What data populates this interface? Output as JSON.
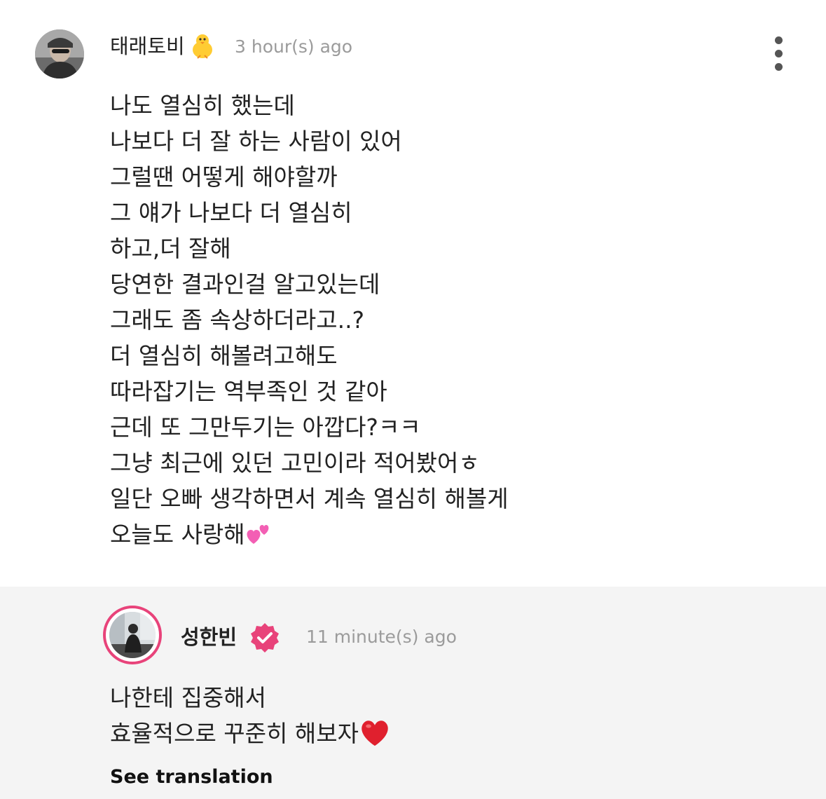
{
  "comment": {
    "username": "태래토비",
    "username_emoji": "chick-icon",
    "time": "3 hour(s) ago",
    "menu_icon": "more-vertical-icon",
    "lines": [
      "나도 열심히 했는데",
      "나보다 더 잘 하는 사람이 있어",
      "그럴땐 어떻게 해야할까",
      "그 얘가 나보다 더 열심히",
      "하고,더 잘해",
      "당연한 결과인걸 알고있는데",
      "그래도 좀 속상하더라고..?",
      "더 열심히 해볼려고해도",
      "따라잡기는 역부족인 것 같아",
      "근데 또 그만두기는 아깝다?ㅋㅋ",
      "그냥 최근에 있던 고민이라 적어봤어ㅎ",
      "일단 오빠 생각하면서 계속 열심히 해볼게",
      "오늘도 사랑해"
    ],
    "last_line_emoji": "two-hearts-icon"
  },
  "reply": {
    "username": "성한빈",
    "badge_icon": "verified-badge-icon",
    "time": "11 minute(s) ago",
    "lines": [
      "나한테 집중해서",
      "효율적으로 꾸준히 해보자"
    ],
    "last_line_emoji": "red-heart-icon",
    "translate_label": "See translation"
  },
  "colors": {
    "background": "#ffffff",
    "reply_background": "#f4f4f4",
    "accent_pink": "#e8437a",
    "timestamp_gray": "#9b9b9b",
    "text": "#222222"
  }
}
